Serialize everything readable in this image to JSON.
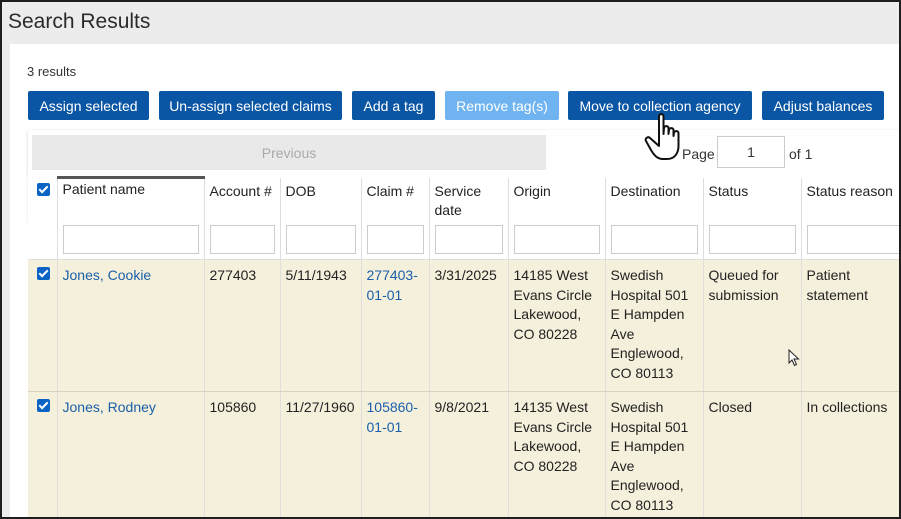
{
  "page": {
    "title": "Search Results",
    "results_count": "3 results"
  },
  "toolbar": {
    "assign": "Assign selected",
    "unassign": "Un-assign selected claims",
    "add_tag": "Add a tag",
    "remove_tag": "Remove tag(s)",
    "collection": "Move to collection agency",
    "adjust": "Adjust balances"
  },
  "pagination": {
    "previous": "Previous",
    "page_label": "Page",
    "page_value": "1",
    "of_label": "of 1"
  },
  "table": {
    "columns": [
      "Patient name",
      "Account #",
      "DOB",
      "Claim #",
      "Service date",
      "Origin",
      "Destination",
      "Status",
      "Status reason"
    ],
    "rows": [
      {
        "patient": "Jones, Cookie",
        "account": "277403",
        "dob": "5/11/1943",
        "claim": "277403-01-01",
        "service_date": "3/31/2025",
        "origin": "14185 West Evans Circle Lakewood, CO 80228",
        "destination": "Swedish Hospital 501 E Hampden Ave Englewood, CO 80113",
        "status": "Queued for submission",
        "status_reason": "Patient statement"
      },
      {
        "patient": "Jones, Rodney",
        "account": "105860",
        "dob": "11/27/1960",
        "claim": "105860-01-01",
        "service_date": "9/8/2021",
        "origin": "14135 West Evans Circle Lakewood, CO 80228",
        "destination": "Swedish Hospital 501 E Hampden Ave Englewood, CO 80113",
        "status": "Closed",
        "status_reason": "In collections"
      }
    ]
  },
  "colors": {
    "primary_button": "#0a56a4",
    "disabled_button": "#6fb3f0",
    "selected_row": "#f5f0dc",
    "link": "#1a5fa8"
  },
  "icons": {
    "pointer": "hand-pointer-icon",
    "cursor": "arrow-cursor-icon"
  }
}
